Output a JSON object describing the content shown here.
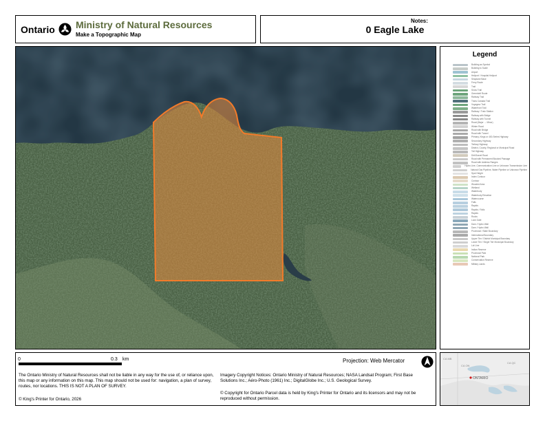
{
  "header": {
    "ontario_word": "Ontario",
    "ministry": "Ministry of Natural Resources",
    "subtitle": "Make a Topographic Map"
  },
  "title_box": {
    "title": "0 Eagle Lake",
    "notes_label": "Notes:"
  },
  "legend": {
    "title": "Legend",
    "items": [
      {
        "label": "Building as Symbol",
        "color": "#b9c4c9"
      },
      {
        "label": "Building to Scale",
        "color": "#c7ccc9"
      },
      {
        "label": "Airport",
        "color": "#9ec3d2"
      },
      {
        "label": "Heliport / Hospital Heliport",
        "color": "#8fc1a2"
      },
      {
        "label": "Seaplane Base",
        "color": "#c6d6df"
      },
      {
        "label": "Ferry Route",
        "color": "#d4dde2"
      },
      {
        "label": "Trail",
        "color": "#d8d8d8"
      },
      {
        "label": "Snow Trail",
        "color": "#6ea57c"
      },
      {
        "label": "Greenbelt Route",
        "color": "#6ea57c"
      },
      {
        "label": "Railway Trail",
        "color": "#8fb89b"
      },
      {
        "label": "Trans Canada Trail",
        "color": "#50707a"
      },
      {
        "label": "Voyageur Trail",
        "color": "#6ea57c"
      },
      {
        "label": "Waterfront Trail",
        "color": "#7fae89"
      },
      {
        "label": "Railway / Train Station",
        "color": "#9a9a9a"
      },
      {
        "label": "Railway with Bridge",
        "color": "#8a8a8a"
      },
      {
        "label": "Railway with Tunnel",
        "color": "#8a8a8a"
      },
      {
        "label": "Road (Major → Minor)",
        "color": "#b5b5b5"
      },
      {
        "label": "Winter Road",
        "color": "#d2d2d2"
      },
      {
        "label": "Road with Bridge",
        "color": "#a9a9a9"
      },
      {
        "label": "Road with Tunnel",
        "color": "#a9a9a9"
      },
      {
        "label": "Primary, Kings or 400-Series Highway",
        "color": "#a3a3a3"
      },
      {
        "label": "Secondary Highway",
        "color": "#b0b0b0"
      },
      {
        "label": "Tertiary Highway",
        "color": "#bdbdbd"
      },
      {
        "label": "District, County, Regional or Municipal Road",
        "color": "#c4c4c4"
      },
      {
        "label": "Toll Highway",
        "color": "#b9b9b9"
      },
      {
        "label": "Dirt/Gravel Road",
        "color": "#d2cbbd"
      },
      {
        "label": "Road with Permanent Blocked Passage",
        "color": "#c9c9c9"
      },
      {
        "label": "Road with Address Ranges",
        "color": "#c2c2c2"
      },
      {
        "label": "Hydro Line, Communication Line or Unknown Transmission Line",
        "color": "#d0d0d0"
      },
      {
        "label": "Natural Gas Pipeline, Water Pipeline or Unknown Pipeline",
        "color": "#d0d0d0"
      },
      {
        "label": "Spot Height",
        "color": "#e2e2e2"
      },
      {
        "label": "Index Contour",
        "color": "#dccab2"
      },
      {
        "label": "Contour",
        "color": "#e6dbca"
      },
      {
        "label": "Wooded Area",
        "color": "#cfe2c7"
      },
      {
        "label": "Wetland",
        "color": "#b6d4c8"
      },
      {
        "label": "Waterbody",
        "color": "#c8dce8"
      },
      {
        "label": "Waterbody Elevation",
        "color": "#cfe0ea"
      },
      {
        "label": "Watercourse",
        "color": "#a9c7da"
      },
      {
        "label": "Falls",
        "color": "#b7cfe0"
      },
      {
        "label": "Rapids",
        "color": "#bcd2e0"
      },
      {
        "label": "Rapids / Falls",
        "color": "#b0cadb"
      },
      {
        "label": "Rapids",
        "color": "#bcd2e0"
      },
      {
        "label": "Rocks",
        "color": "#c9d2d8"
      },
      {
        "label": "Lock Gate",
        "color": "#8aa8ba"
      },
      {
        "label": "Dam / Hydro Wall",
        "color": "#8fa6b3"
      },
      {
        "label": "Dam / Hydro Wall",
        "color": "#8fa6b3"
      },
      {
        "label": "Provincial / State Boundary",
        "color": "#b8b8b8"
      },
      {
        "label": "International Boundary",
        "color": "#a9a9a9"
      },
      {
        "label": "Upper Tier / District Municipal Boundary",
        "color": "#c7c7c7"
      },
      {
        "label": "Lower Tier / Single Tier Municipal Boundary",
        "color": "#cecece"
      },
      {
        "label": "Lot Line",
        "color": "#dadada"
      },
      {
        "label": "Indian Reserve",
        "color": "#e9d9b0"
      },
      {
        "label": "Provincial Park",
        "color": "#c9e0b5"
      },
      {
        "label": "National Park",
        "color": "#b8d9b0"
      },
      {
        "label": "Conservation Reserve",
        "color": "#d8e7c0"
      },
      {
        "label": "Military Lands",
        "color": "#e8c9b6"
      }
    ]
  },
  "scale": {
    "zero": "0",
    "max": "0.3",
    "unit": "km"
  },
  "projection": "Projection: Web Mercator",
  "disclaimer": "The Ontario Ministry of Natural Resources shall not be liable in any way for the use of, or reliance upon, this map or any information on this map.  This map should not be used for: navigation, a plan of survey, routes, nor locations. THIS IS NOT A PLAN OF SURVEY.",
  "copyright_kp": "© King's Printer for Ontario,  2026",
  "imagery_notice": "Imagery Copyright Notices: Ontario Ministry of Natural Resources; NASA Landsat Program; First Base Solutions Inc.; Aéro-Photo (1961) Inc.; DigitalGlobe Inc.; U.S. Geological Survey.",
  "parcel_notice": "© Copyright for Ontario Parcel data is held by King's Printer for Ontario and its licensors and may not be reproduced without permission.",
  "locator": {
    "label_ontario": "ONTARIO",
    "label_ca_mb": "CA MB",
    "label_ca_qc": "CA QC",
    "label_ca_on": "CA ON"
  },
  "colors": {
    "ministry_green": "#5c6b3c",
    "water": "#243845",
    "forest": "#41573a",
    "parcel_fill": "#e88a3c",
    "parcel_stroke": "#f27b2a"
  }
}
